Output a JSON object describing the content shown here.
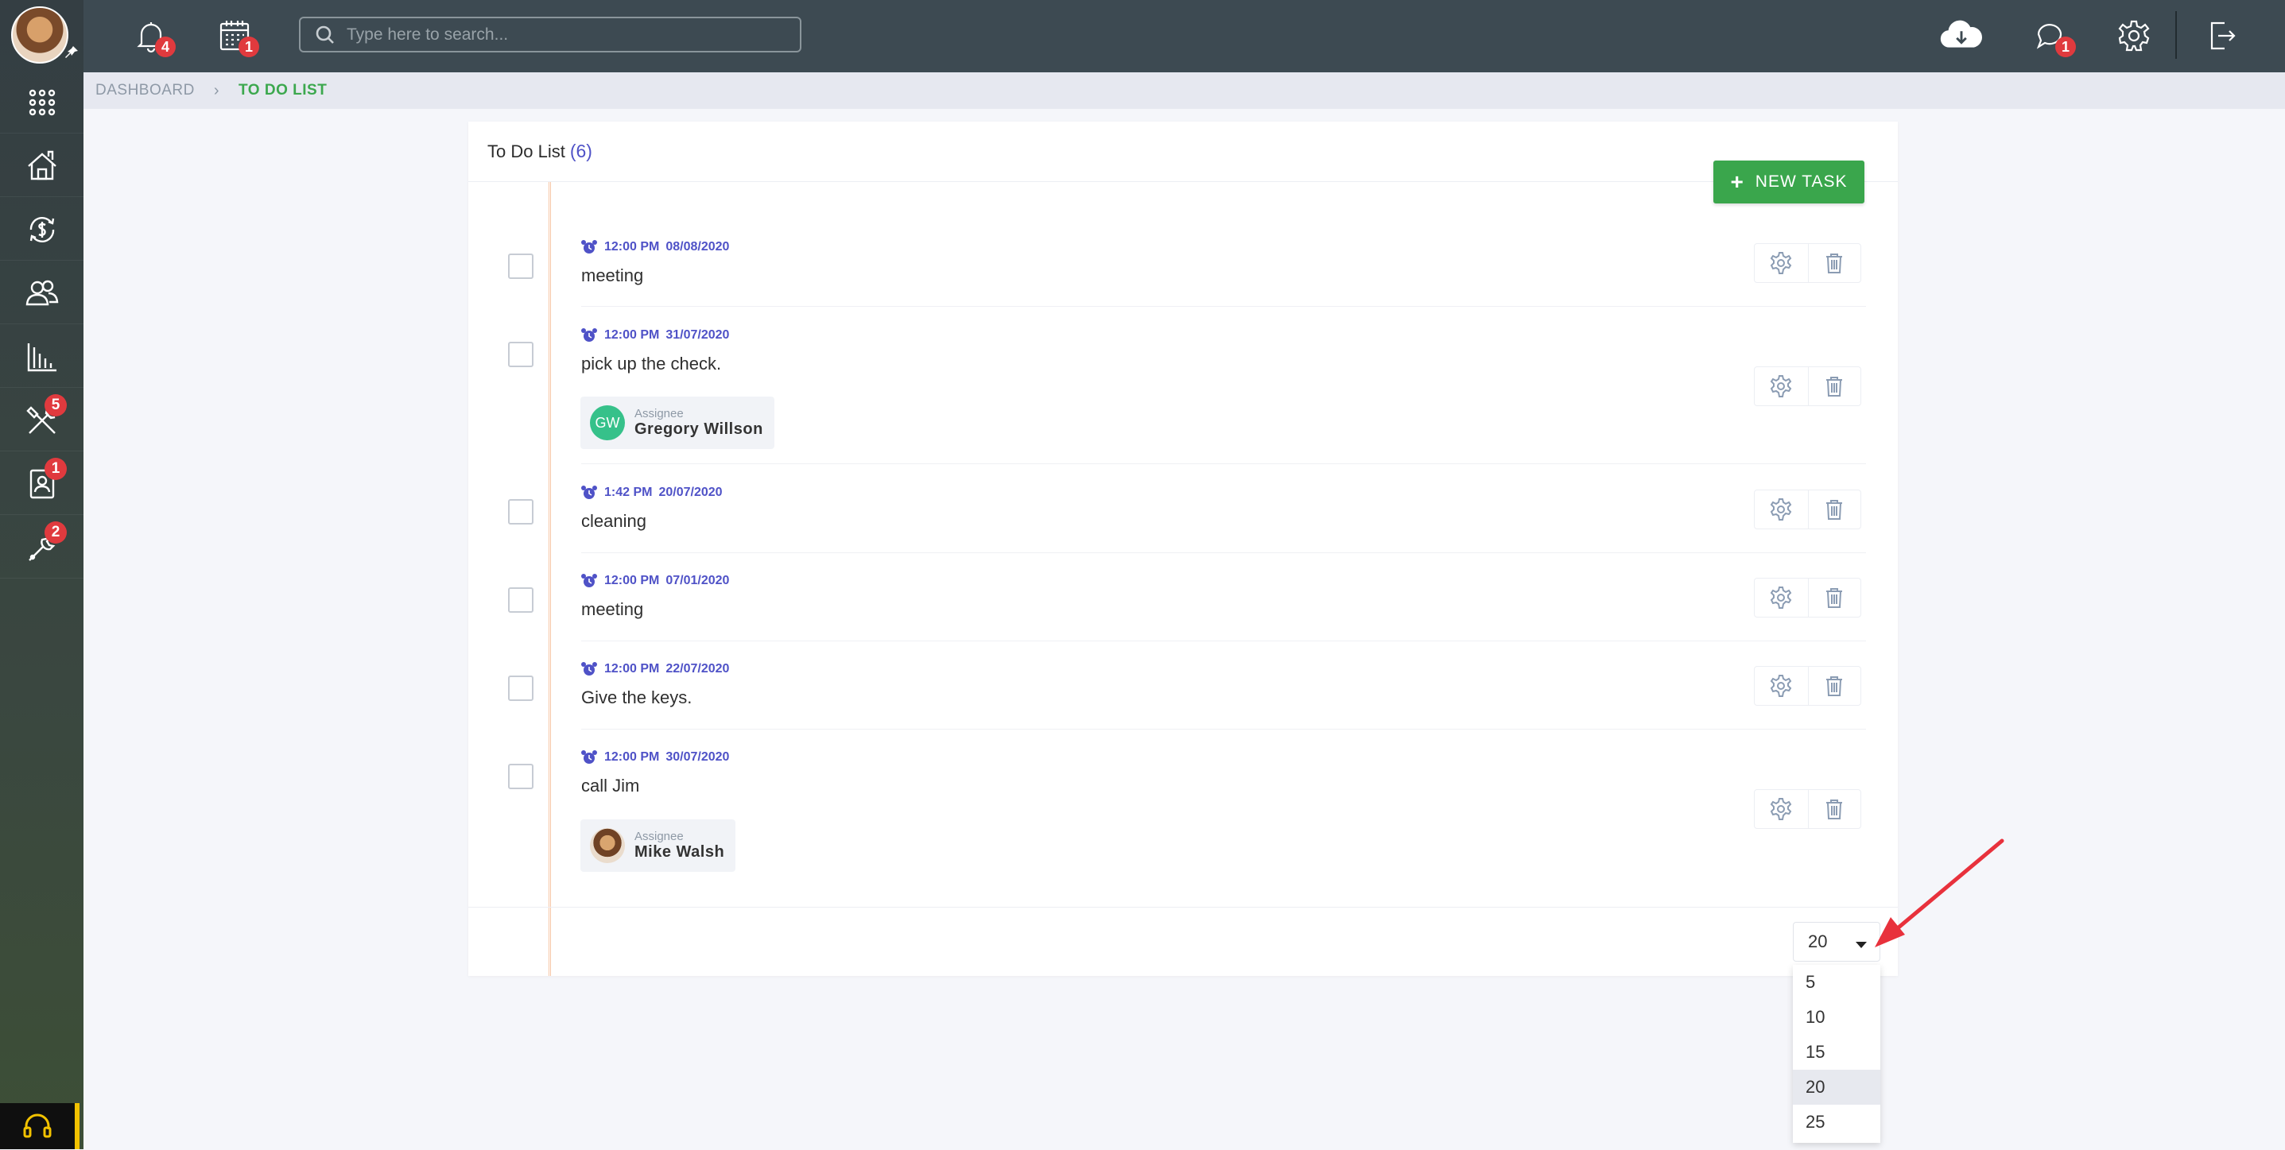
{
  "topbar": {
    "notifications_badge": "4",
    "calendar_badge": "1",
    "search_placeholder": "Type here to search...",
    "chat_badge": "1"
  },
  "sidebar": {
    "tools_badge": "5",
    "contacts_badge": "1",
    "settings_badge": "2"
  },
  "breadcrumb": {
    "home": "DASHBOARD",
    "current": "TO DO LIST"
  },
  "todo": {
    "title": "To Do List",
    "count": "(6)",
    "new_task_label": "NEW TASK",
    "tasks": [
      {
        "time": "12:00 PM",
        "date": "08/08/2020",
        "text": "meeting"
      },
      {
        "time": "12:00 PM",
        "date": "31/07/2020",
        "text": "pick up the check.",
        "assignee_label": "Assignee",
        "assignee_name": "Gregory Willson",
        "assignee_initials": "GW"
      },
      {
        "time": "1:42 PM",
        "date": "20/07/2020",
        "text": "cleaning"
      },
      {
        "time": "12:00 PM",
        "date": "07/01/2020",
        "text": "meeting"
      },
      {
        "time": "12:00 PM",
        "date": "22/07/2020",
        "text": "Give the keys."
      },
      {
        "time": "12:00 PM",
        "date": "30/07/2020",
        "text": "call Jim",
        "assignee_label": "Assignee",
        "assignee_name": "Mike Walsh"
      }
    ]
  },
  "page_size": {
    "selected": "20",
    "options": [
      "5",
      "10",
      "15",
      "20",
      "25"
    ]
  },
  "colors": {
    "accent": "#4f52c7",
    "green": "#3aa64c",
    "badge": "#e03a3e"
  }
}
